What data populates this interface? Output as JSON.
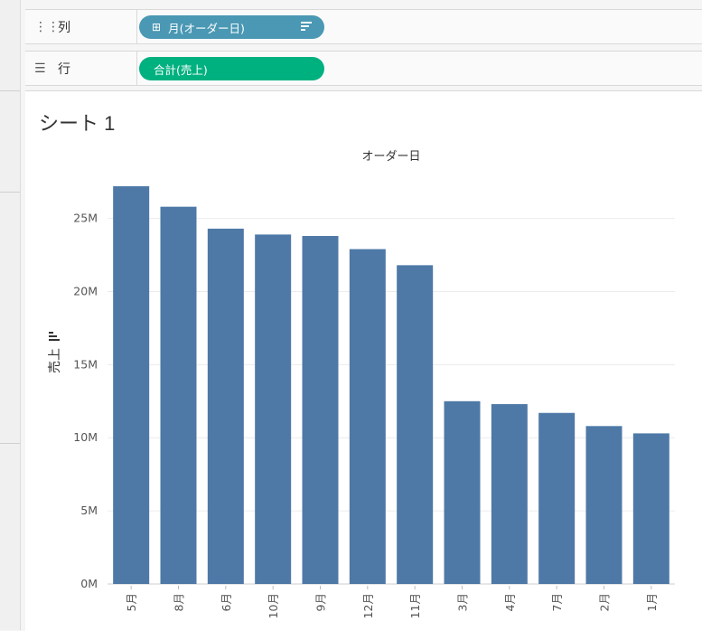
{
  "columns_shelf": {
    "icon": "columns-icon",
    "label": "列",
    "pill": {
      "icon": "expand-plus-icon",
      "text": "月(オーダー日)",
      "color": "#4a98b4",
      "sort_icon": "sort-descending-icon"
    }
  },
  "rows_shelf": {
    "icon": "rows-icon",
    "label": "行",
    "pill": {
      "text": "合計(売上)",
      "color": "#00b180"
    }
  },
  "sheet": {
    "title": "シート 1"
  },
  "chart_data": {
    "type": "bar",
    "title": "オーダー日",
    "ylabel": "売上",
    "ylabel_icon": "sort-icon",
    "categories": [
      "5月",
      "8月",
      "6月",
      "10月",
      "9月",
      "12月",
      "11月",
      "3月",
      "4月",
      "7月",
      "2月",
      "1月"
    ],
    "values": [
      27.2,
      25.8,
      24.3,
      23.9,
      23.8,
      22.9,
      21.8,
      12.5,
      12.3,
      11.7,
      10.8,
      10.3
    ],
    "value_unit": "M",
    "ylim": [
      0,
      28.5
    ],
    "yticks": [
      0,
      5,
      10,
      15,
      20,
      25
    ],
    "ytick_labels": [
      "0M",
      "5M",
      "10M",
      "15M",
      "20M",
      "25M"
    ],
    "bar_color": "#4e79a7",
    "grid": true
  }
}
